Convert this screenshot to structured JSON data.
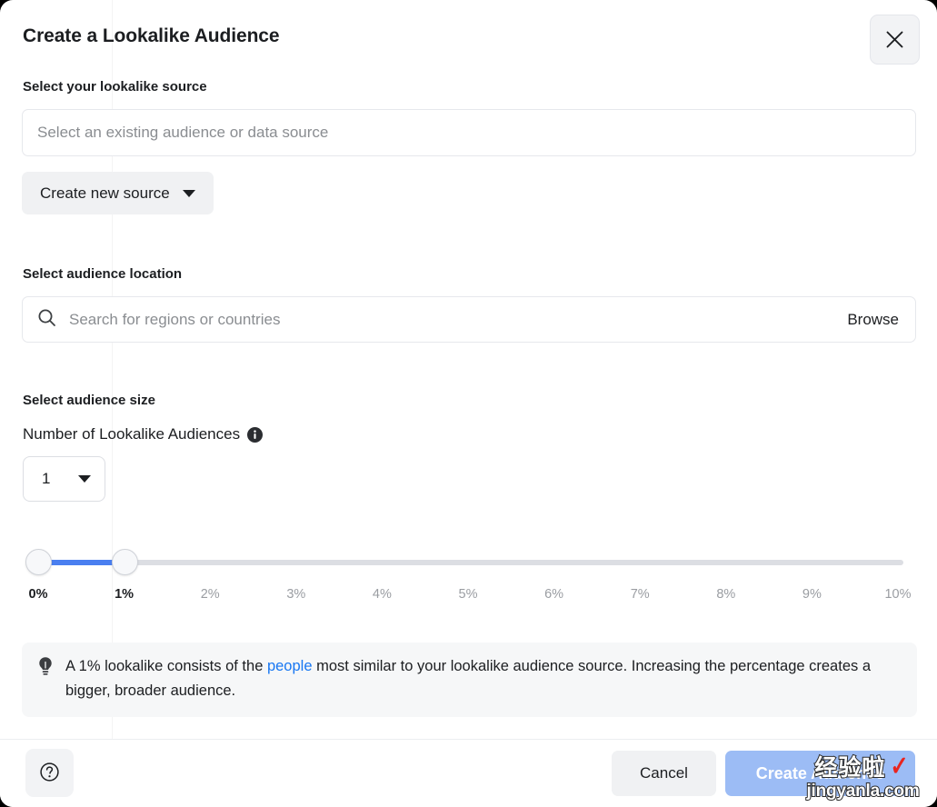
{
  "dialog": {
    "title": "Create a Lookalike Audience",
    "close_icon": "close-icon"
  },
  "source": {
    "label": "Select your lookalike source",
    "select_placeholder": "Select an existing audience or data source",
    "create_new_label": "Create new source",
    "caret_icon": "chevron-down-icon"
  },
  "location": {
    "label": "Select audience location",
    "search_placeholder": "Search for regions or countries",
    "search_icon": "search-icon",
    "browse_label": "Browse"
  },
  "size": {
    "label": "Select audience size",
    "number_label": "Number of Lookalike Audiences",
    "info_icon": "info-icon",
    "number_value": "1",
    "caret_icon": "chevron-down-icon"
  },
  "slider": {
    "min_value": "0%",
    "max_value": "1%",
    "range_start": 0,
    "range_end": 10,
    "fill_color": "#4a7ff0",
    "track_color": "#dcdee3",
    "ticks": [
      {
        "label": "0%",
        "active": true
      },
      {
        "label": "1%",
        "active": true
      },
      {
        "label": "2%",
        "active": false
      },
      {
        "label": "3%",
        "active": false
      },
      {
        "label": "4%",
        "active": false
      },
      {
        "label": "5%",
        "active": false
      },
      {
        "label": "6%",
        "active": false
      },
      {
        "label": "7%",
        "active": false
      },
      {
        "label": "8%",
        "active": false
      },
      {
        "label": "9%",
        "active": false
      },
      {
        "label": "10%",
        "active": false
      }
    ]
  },
  "tip": {
    "icon": "lightbulb-icon",
    "text_before": "A 1% lookalike consists of the ",
    "link_text": "people",
    "text_after": " most similar to your lookalike audience source. Increasing the percentage creates a bigger, broader audience.",
    "link_color": "#1877f2"
  },
  "footer": {
    "help_icon": "question-mark-circle-icon",
    "cancel_label": "Cancel",
    "create_label": "Create Audience",
    "create_color": "#9cbcf5"
  },
  "watermark": {
    "brand": "经验啦",
    "check": "✓",
    "url": "jingyanla.com"
  }
}
